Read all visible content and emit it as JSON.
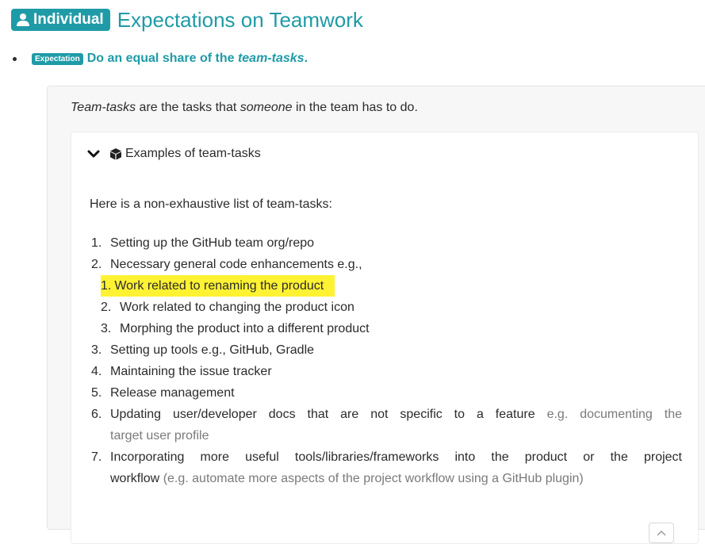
{
  "header": {
    "badge_label": "Individual",
    "title": "Expectations on Teamwork"
  },
  "expectation": {
    "badge_label": "Expectation",
    "text_before": "Do an equal share of the ",
    "text_em": "team-tasks",
    "text_after": "."
  },
  "panel": {
    "intro_em1": "Team-tasks",
    "intro_mid": " are the tasks that ",
    "intro_em2": "someone",
    "intro_end": " in the team has to do."
  },
  "details": {
    "summary_label": "Examples of team-tasks",
    "lead": "Here is a non-exhaustive list of team-tasks:",
    "items": [
      {
        "num": "1.",
        "text": "Setting up the GitHub team org/repo"
      },
      {
        "num": "2.",
        "text": "Necessary general code enhancements e.g.,"
      },
      {
        "num": "3.",
        "text": "Setting up tools e.g., GitHub, Gradle"
      },
      {
        "num": "4.",
        "text": "Maintaining the issue tracker"
      },
      {
        "num": "5.",
        "text": "Release management"
      },
      {
        "num": "6.",
        "text_a": "Updating user/developer docs that are not specific to a feature",
        "muted_a": "e.g. documenting the",
        "muted_b": "target user profile"
      },
      {
        "num": "7.",
        "text_a": "Incorporating more useful tools/libraries/frameworks into the product or the project",
        "text_b": "workflow",
        "muted_b": "(e.g. automate more aspects of the project workflow using a GitHub plugin)"
      }
    ],
    "sub_items": [
      {
        "num": "1.",
        "text": "Work related to renaming the product",
        "highlighted": true
      },
      {
        "num": "2.",
        "text": "Work related to changing the product icon"
      },
      {
        "num": "3.",
        "text": "Morphing the product into a different product"
      }
    ]
  },
  "icons": {
    "badge_icon": "user-icon",
    "summary_toggle": "chevron-down-icon",
    "summary_icon": "cube-icon",
    "scroll": "chevron-up-icon"
  },
  "colors": {
    "accent": "#1f9ba7",
    "highlight": "#fff233",
    "panel_bg": "#f7f7f8",
    "muted_text": "#7a7a7a"
  }
}
